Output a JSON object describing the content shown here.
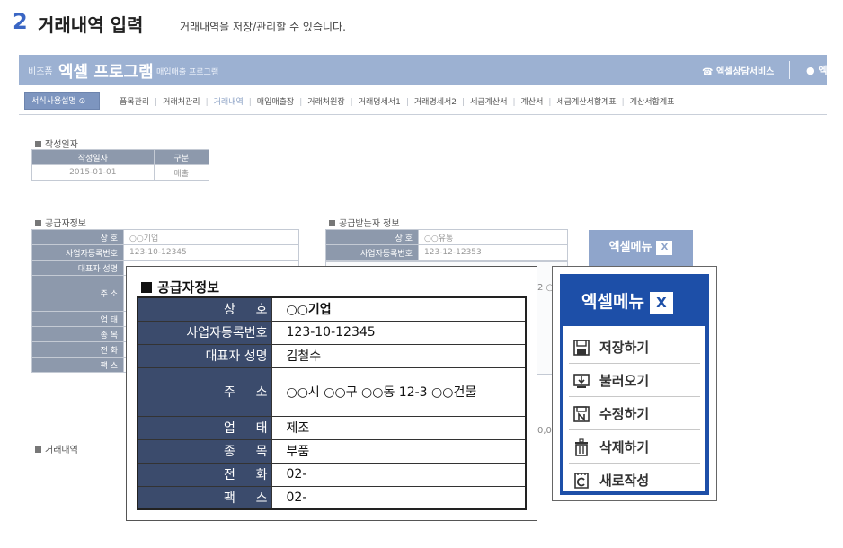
{
  "heading": {
    "step_number": "2",
    "title": "거래내역 입력",
    "subtitle": "거래내역을 저장/관리할 수 있습니다."
  },
  "app": {
    "brand_small": "비즈폼",
    "brand_main": "엑셀 프로그램",
    "brand_sub": "매입매출 프로그램",
    "consult_label": "엑셀상담서비스",
    "pin_label": "엑",
    "guide_button": "서식사용설명",
    "nav": [
      "품목관리",
      "거래처관리",
      "거래내역",
      "매입매출장",
      "거래처원장",
      "거래명세서1",
      "거래명세서2",
      "세금계산서",
      "계산서",
      "세금계산서합계표",
      "계산서합계표"
    ],
    "nav_active": "거래내역",
    "date_section": {
      "title": "작성일자",
      "headers": [
        "작성일자",
        "구분"
      ],
      "values": [
        "2015-01-01",
        "매출"
      ]
    },
    "supplier_section": {
      "title": "공급자정보",
      "rows": [
        {
          "label": "상 호",
          "value": "○○기업"
        },
        {
          "label": "사업자등록번호",
          "value": "123-10-12345"
        },
        {
          "label": "대표자 성명",
          "value": ""
        },
        {
          "label": "주 소",
          "value": ""
        },
        {
          "label": "업 태",
          "value": ""
        },
        {
          "label": "종 목",
          "value": ""
        },
        {
          "label": "전 화",
          "value": ""
        },
        {
          "label": "팩 스",
          "value": ""
        }
      ]
    },
    "receiver_section": {
      "title": "공급받는자 정보",
      "rows": [
        {
          "label": "상 호",
          "value": "○○유통"
        },
        {
          "label": "사업자등록번호",
          "value": "123-12-12353"
        }
      ],
      "fragment_1": "2 ○",
      "fragment_2": "0,00"
    },
    "excel_button": "엑셀메뉴",
    "history_title": "거래내역"
  },
  "callout_supplier": {
    "title": "공급자정보",
    "rows": [
      {
        "label": "상 호",
        "value": "○○기업"
      },
      {
        "label": "사업자등록번호",
        "value": "123-10-12345"
      },
      {
        "label": "대표자 성명",
        "value": "김철수"
      },
      {
        "label": "주 소",
        "value": "○○시 ○○구 ○○동 12-3 ○○건물"
      },
      {
        "label": "업 태",
        "value": "제조"
      },
      {
        "label": "종 목",
        "value": "부품"
      },
      {
        "label": "전 화",
        "value": "02-"
      },
      {
        "label": "팩 스",
        "value": "02-"
      }
    ]
  },
  "callout_excel_menu": {
    "title": "엑셀메뉴",
    "xl_glyph": "X",
    "items": [
      {
        "label": "저장하기",
        "icon": "save-icon"
      },
      {
        "label": "불러오기",
        "icon": "load-icon"
      },
      {
        "label": "수정하기",
        "icon": "edit-icon"
      },
      {
        "label": "삭제하기",
        "icon": "trash-icon"
      },
      {
        "label": "새로작성",
        "icon": "new-document-icon"
      }
    ]
  },
  "colors": {
    "accent_blue": "#3a66c4",
    "topbar": "#9cb1d2",
    "table_header": "#3b4b6c",
    "excel_menu_blue": "#1d4fa8"
  }
}
